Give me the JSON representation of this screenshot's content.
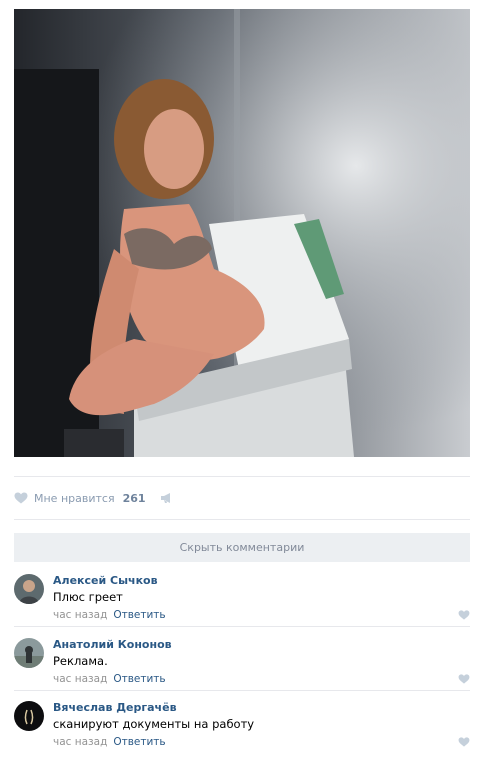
{
  "photo": {
    "alt": "photo"
  },
  "actions": {
    "like_label": "Мне нравится",
    "like_count": "261"
  },
  "comments_toggle": "Скрыть комментарии",
  "comments": [
    {
      "author": "Алексей Сычков",
      "text": "Плюс греет",
      "time": "час назад",
      "reply": "Ответить"
    },
    {
      "author": "Анатолий Кононов",
      "text": "Реклама.",
      "time": "час назад",
      "reply": "Ответить"
    },
    {
      "author": "Вячеслав Дергачёв",
      "text": "сканируют документы на работу",
      "time": "час назад",
      "reply": "Ответить"
    }
  ],
  "colors": {
    "link": "#2a5885",
    "muted": "#939393",
    "like_icon": "#c5d0db",
    "bar_bg": "#eceff2"
  },
  "icons": [
    "heart-icon",
    "megaphone-icon"
  ]
}
